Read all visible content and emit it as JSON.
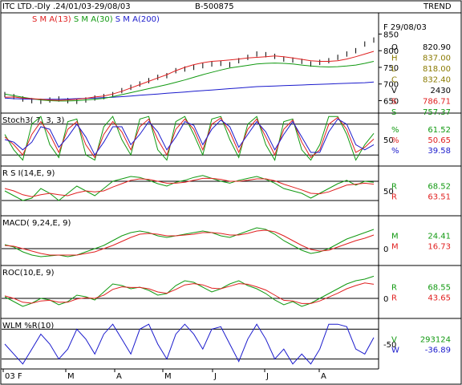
{
  "header": {
    "title": "ITC LTD.-Dly .24/01/03-29/08/03",
    "code": "B-500875",
    "view": "TREND"
  },
  "colors": {
    "sma13": "#e02020",
    "sma30": "#119911",
    "sma200": "#1a1acc",
    "price": "#000000",
    "ohlc_o": "#000000",
    "ohlc_h": "#8a7a00",
    "ohlc_l": "#8a7a00",
    "ohlc_c": "#8a7a00",
    "ohlc_v": "#000000",
    "s786": "#e02020",
    "s757": "#119911"
  },
  "chart_data": [
    {
      "type": "line",
      "panel": "price",
      "title": "ITC LTD.-Dly .24/01/03-29/08/03",
      "legend": [
        "S M A(13)",
        "S M A(30)",
        "S M A(200)"
      ],
      "yticks": [
        "850",
        "800",
        "750",
        "700",
        "650"
      ],
      "ylim": [
        615,
        880
      ],
      "date_label": "F 29/08/03",
      "readouts": [
        {
          "k": "O",
          "v": "820.90"
        },
        {
          "k": "H",
          "v": "837.00"
        },
        {
          "k": "L",
          "v": "818.00"
        },
        {
          "k": "C",
          "v": "832.40"
        },
        {
          "k": "V",
          "v": "2430"
        },
        {
          "k": "S",
          "v": "786.71"
        },
        {
          "k": "S",
          "v": "757.37"
        }
      ],
      "x_months": [
        "03 F",
        "M",
        "A",
        "M",
        "J",
        "J",
        "A"
      ],
      "series": [
        {
          "name": "S M A(13)",
          "values": [
            660,
            661,
            658,
            656,
            654,
            652,
            651,
            652,
            654,
            657,
            661,
            664,
            670,
            678,
            688,
            698,
            708,
            718,
            728,
            740,
            750,
            758,
            764,
            768,
            770,
            772,
            775,
            778,
            780,
            782,
            784,
            782,
            778,
            774,
            770,
            768,
            768,
            770,
            775,
            782,
            790,
            798
          ]
        },
        {
          "name": "S M A(30)",
          "values": [
            670,
            665,
            660,
            656,
            652,
            650,
            649,
            649,
            650,
            652,
            654,
            657,
            662,
            668,
            674,
            680,
            686,
            692,
            698,
            705,
            712,
            720,
            728,
            735,
            742,
            748,
            752,
            756,
            760,
            762,
            763,
            762,
            760,
            757,
            754,
            752,
            751,
            752,
            754,
            757,
            762,
            768
          ]
        },
        {
          "name": "S M A(200)",
          "values": [
            658,
            656,
            655,
            654,
            654,
            654,
            654,
            655,
            656,
            657,
            658,
            659,
            660,
            662,
            664,
            666,
            668,
            670,
            672,
            674,
            676,
            678,
            680,
            682,
            684,
            686,
            688,
            690,
            692,
            693,
            694,
            695,
            696,
            697,
            698,
            699,
            700,
            701,
            702,
            703,
            704,
            706
          ]
        }
      ],
      "close": [
        668,
        662,
        655,
        650,
        648,
        652,
        655,
        650,
        648,
        652,
        658,
        662,
        668,
        680,
        690,
        700,
        710,
        720,
        725,
        740,
        745,
        750,
        755,
        760,
        762,
        758,
        770,
        780,
        790,
        788,
        783,
        775,
        772,
        768,
        760,
        765,
        770,
        780,
        790,
        800,
        820,
        832
      ]
    },
    {
      "type": "line",
      "panel": "stochastic",
      "title": "Stoch3( 7, 3, 3)",
      "ylim": [
        0,
        100
      ],
      "yticks": [
        "50"
      ],
      "readouts": [
        {
          "k": "%",
          "v": "61.52"
        },
        {
          "k": "%",
          "v": "50.65"
        },
        {
          "k": "%",
          "v": "39.58"
        }
      ],
      "series": [
        {
          "name": "%K",
          "values": [
            60,
            30,
            10,
            80,
            95,
            40,
            15,
            85,
            90,
            20,
            10,
            75,
            95,
            50,
            20,
            90,
            95,
            30,
            10,
            85,
            95,
            60,
            20,
            90,
            95,
            50,
            15,
            80,
            95,
            40,
            10,
            85,
            90,
            30,
            10,
            40,
            95,
            95,
            60,
            10,
            40,
            62
          ]
        },
        {
          "name": "%D",
          "values": [
            55,
            40,
            20,
            60,
            85,
            60,
            25,
            70,
            85,
            40,
            15,
            60,
            85,
            65,
            30,
            75,
            90,
            50,
            20,
            70,
            90,
            70,
            30,
            80,
            92,
            65,
            25,
            70,
            90,
            55,
            20,
            70,
            88,
            45,
            15,
            30,
            80,
            93,
            70,
            25,
            35,
            51
          ]
        },
        {
          "name": "Slow",
          "values": [
            50,
            45,
            30,
            45,
            75,
            70,
            35,
            55,
            80,
            55,
            20,
            45,
            75,
            75,
            40,
            60,
            85,
            65,
            30,
            55,
            85,
            78,
            40,
            70,
            88,
            75,
            35,
            60,
            85,
            65,
            30,
            60,
            85,
            55,
            25,
            25,
            65,
            90,
            80,
            40,
            30,
            40
          ]
        }
      ]
    },
    {
      "type": "line",
      "panel": "rsi",
      "title": "R S I(14,E, 9)",
      "ylim": [
        0,
        100
      ],
      "yticks": [
        "50"
      ],
      "readouts": [
        {
          "k": "R",
          "v": "68.52"
        },
        {
          "k": "R",
          "v": "63.51"
        }
      ],
      "series": [
        {
          "name": "RSI",
          "values": [
            50,
            40,
            30,
            35,
            55,
            45,
            30,
            45,
            60,
            50,
            40,
            55,
            70,
            75,
            80,
            78,
            72,
            65,
            60,
            68,
            72,
            78,
            82,
            76,
            70,
            66,
            72,
            76,
            80,
            74,
            66,
            55,
            50,
            45,
            35,
            45,
            55,
            65,
            72,
            62,
            70,
            68
          ]
        },
        {
          "name": "Signal",
          "values": [
            55,
            50,
            42,
            38,
            42,
            45,
            42,
            40,
            46,
            50,
            48,
            50,
            58,
            65,
            72,
            75,
            74,
            70,
            66,
            66,
            68,
            72,
            76,
            76,
            74,
            70,
            70,
            72,
            75,
            75,
            71,
            64,
            58,
            52,
            45,
            44,
            48,
            55,
            62,
            64,
            66,
            64
          ]
        }
      ]
    },
    {
      "type": "line",
      "panel": "macd",
      "title": "MACD( 9,24,E, 9)",
      "yticks": [
        "0"
      ],
      "ylim": [
        -20,
        40
      ],
      "readouts": [
        {
          "k": "M",
          "v": "24.41"
        },
        {
          "k": "M",
          "v": "16.73"
        }
      ],
      "series": [
        {
          "name": "MACD",
          "values": [
            5,
            2,
            -4,
            -8,
            -10,
            -9,
            -8,
            -10,
            -8,
            -4,
            0,
            4,
            10,
            16,
            20,
            22,
            20,
            16,
            14,
            16,
            18,
            20,
            22,
            20,
            16,
            14,
            18,
            22,
            26,
            24,
            18,
            10,
            4,
            -2,
            -6,
            -4,
            0,
            6,
            12,
            16,
            20,
            24
          ]
        },
        {
          "name": "Signal",
          "values": [
            4,
            3,
            0,
            -3,
            -6,
            -8,
            -8,
            -8,
            -8,
            -6,
            -4,
            0,
            4,
            9,
            14,
            18,
            19,
            18,
            16,
            16,
            17,
            18,
            20,
            20,
            19,
            17,
            17,
            19,
            22,
            23,
            21,
            16,
            10,
            4,
            -1,
            -3,
            -2,
            2,
            6,
            10,
            13,
            17
          ]
        }
      ]
    },
    {
      "type": "line",
      "panel": "roc",
      "title": "ROC(10,E, 9)",
      "yticks": [
        "0"
      ],
      "ylim": [
        -60,
        100
      ],
      "readouts": [
        {
          "k": "R",
          "v": "68.55"
        },
        {
          "k": "R",
          "v": "43.65"
        }
      ],
      "series": [
        {
          "name": "ROC",
          "values": [
            5,
            -10,
            -25,
            -15,
            0,
            -5,
            -20,
            -10,
            10,
            5,
            -5,
            20,
            45,
            40,
            30,
            35,
            25,
            10,
            15,
            40,
            55,
            50,
            35,
            20,
            30,
            45,
            55,
            40,
            30,
            15,
            -5,
            -20,
            -10,
            -25,
            -15,
            0,
            15,
            30,
            45,
            55,
            60,
            69
          ]
        },
        {
          "name": "Signal",
          "values": [
            8,
            0,
            -12,
            -15,
            -8,
            -6,
            -12,
            -12,
            -2,
            2,
            0,
            10,
            28,
            36,
            34,
            34,
            30,
            20,
            16,
            28,
            42,
            46,
            42,
            32,
            30,
            38,
            46,
            44,
            36,
            26,
            10,
            -6,
            -8,
            -16,
            -16,
            -8,
            4,
            16,
            30,
            40,
            48,
            44
          ]
        }
      ]
    },
    {
      "type": "line",
      "panel": "williams",
      "title": "WLM %R(10)",
      "yticks": [
        "-50"
      ],
      "ylim": [
        -100,
        0
      ],
      "readouts": [
        {
          "k": "V",
          "v": "293124"
        },
        {
          "k": "W",
          "v": "-36.89"
        }
      ],
      "series": [
        {
          "name": "%R",
          "values": [
            -50,
            -70,
            -90,
            -60,
            -30,
            -50,
            -80,
            -60,
            -20,
            -40,
            -70,
            -30,
            -10,
            -40,
            -70,
            -20,
            -10,
            -50,
            -80,
            -30,
            -10,
            -30,
            -60,
            -20,
            -15,
            -50,
            -85,
            -40,
            -10,
            -40,
            -80,
            -60,
            -90,
            -70,
            -90,
            -60,
            -10,
            -10,
            -15,
            -60,
            -70,
            -37
          ]
        }
      ]
    }
  ],
  "panels": {
    "stoch_title": "Stoch3( 7, 3, 3)",
    "rsi_title": "R S I(14,E, 9)",
    "macd_title": "MACD( 9,24,E, 9)",
    "roc_title": "ROC(10,E, 9)",
    "wlm_title": "WLM %R(10)"
  }
}
